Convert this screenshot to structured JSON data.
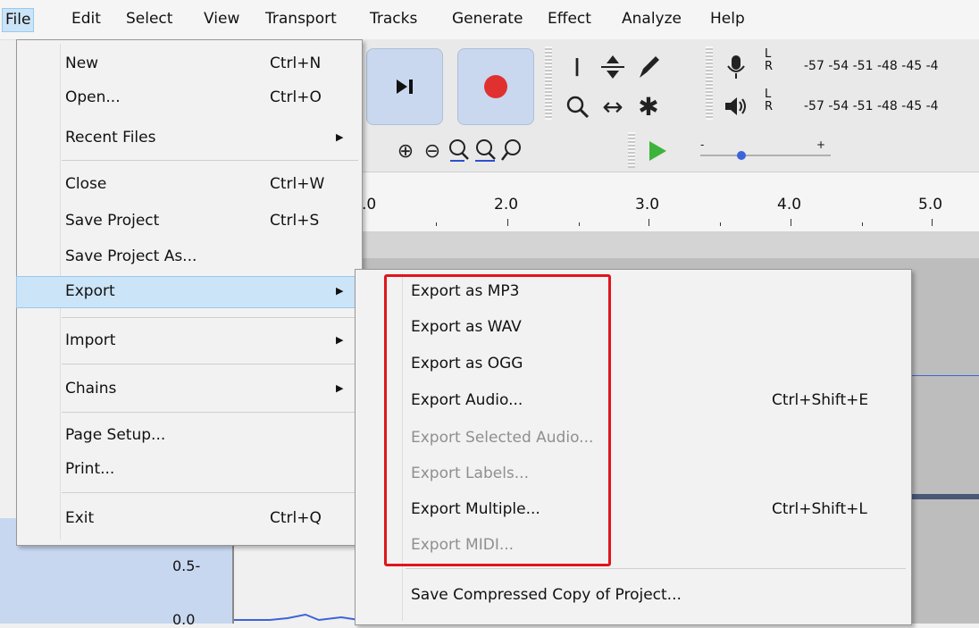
{
  "menubar": {
    "items": [
      "File",
      "Edit",
      "Select",
      "View",
      "Transport",
      "Tracks",
      "Generate",
      "Effect",
      "Analyze",
      "Help"
    ],
    "active": "File"
  },
  "meters": {
    "rec_scale": "-57 -54 -51 -48 -45 -4",
    "play_scale": "-57 -54 -51 -48 -45 -4",
    "left_label": "L",
    "right_label": "R"
  },
  "ruler": {
    "labels": [
      ".0",
      "2.0",
      "3.0",
      "4.0",
      "5.0"
    ]
  },
  "track": {
    "amplitude_labels": [
      "0.5-",
      "0.0"
    ]
  },
  "file_menu": {
    "items": [
      {
        "label": "New",
        "shortcut": "Ctrl+N"
      },
      {
        "label": "Open...",
        "shortcut": "Ctrl+O"
      },
      {
        "label": "Recent Files",
        "shortcut": ""
      },
      {
        "label": "Close",
        "shortcut": "Ctrl+W"
      },
      {
        "label": "Save Project",
        "shortcut": "Ctrl+S"
      },
      {
        "label": "Save Project As...",
        "shortcut": ""
      },
      {
        "label": "Export",
        "shortcut": ""
      },
      {
        "label": "Import",
        "shortcut": ""
      },
      {
        "label": "Chains",
        "shortcut": ""
      },
      {
        "label": "Page Setup...",
        "shortcut": ""
      },
      {
        "label": "Print...",
        "shortcut": ""
      },
      {
        "label": "Exit",
        "shortcut": "Ctrl+Q"
      }
    ],
    "submenu_arrow": "▶"
  },
  "export_menu": {
    "items": [
      {
        "label": "Export as MP3",
        "shortcut": "",
        "enabled": true
      },
      {
        "label": "Export as WAV",
        "shortcut": "",
        "enabled": true
      },
      {
        "label": "Export as OGG",
        "shortcut": "",
        "enabled": true
      },
      {
        "label": "Export Audio...",
        "shortcut": "Ctrl+Shift+E",
        "enabled": true
      },
      {
        "label": "Export Selected Audio...",
        "shortcut": "",
        "enabled": false
      },
      {
        "label": "Export Labels...",
        "shortcut": "",
        "enabled": false
      },
      {
        "label": "Export Multiple...",
        "shortcut": "Ctrl+Shift+L",
        "enabled": true
      },
      {
        "label": "Export MIDI...",
        "shortcut": "",
        "enabled": false
      },
      {
        "label": "Save Compressed Copy of Project...",
        "shortcut": "",
        "enabled": true
      }
    ]
  },
  "colors": {
    "highlight_box": "#e0151b",
    "menu_hover": "#cce4f7",
    "record": "#e03131",
    "play_green": "#3cb43c"
  },
  "icons": {
    "skip_end": "skip-to-end-icon",
    "record": "record-icon",
    "selection_tool": "selection-tool-icon",
    "envelope_tool": "envelope-tool-icon",
    "draw_tool": "draw-tool-icon",
    "zoom_tool": "zoom-tool-icon",
    "timeshift_tool": "time-shift-tool-icon",
    "multi_tool": "multi-tool-icon",
    "microphone": "microphone-icon",
    "speaker": "speaker-icon",
    "play_at_speed": "play-at-speed-icon"
  }
}
